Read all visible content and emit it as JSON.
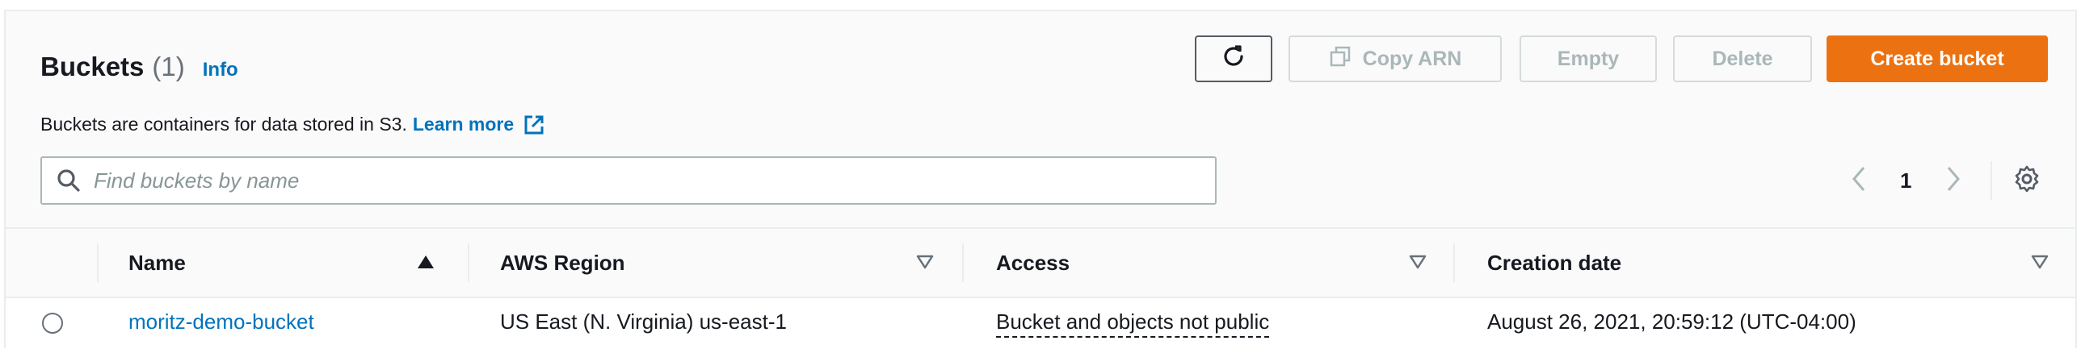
{
  "header": {
    "title": "Buckets",
    "count": "(1)",
    "info_label": "Info",
    "description": "Buckets are containers for data stored in S3.",
    "learn_more": "Learn more"
  },
  "actions": {
    "refresh_icon": "refresh-icon",
    "copy_arn": "Copy ARN",
    "empty": "Empty",
    "delete": "Delete",
    "create": "Create bucket"
  },
  "search": {
    "placeholder": "Find buckets by name",
    "value": ""
  },
  "pagination": {
    "page": "1"
  },
  "table": {
    "columns": [
      {
        "label": "Name",
        "sort": "ascending"
      },
      {
        "label": "AWS Region",
        "sort": "none"
      },
      {
        "label": "Access",
        "sort": "none"
      },
      {
        "label": "Creation date",
        "sort": "none"
      }
    ],
    "rows": [
      {
        "name": "moritz-demo-bucket",
        "region": "US East (N. Virginia) us-east-1",
        "access": "Bucket and objects not public",
        "created": "August 26, 2021, 20:59:12 (UTC-04:00)"
      }
    ]
  },
  "colors": {
    "primary": "#ec7211",
    "link": "#0073bb",
    "text": "#16191f",
    "disabled": "#aab7b8"
  }
}
